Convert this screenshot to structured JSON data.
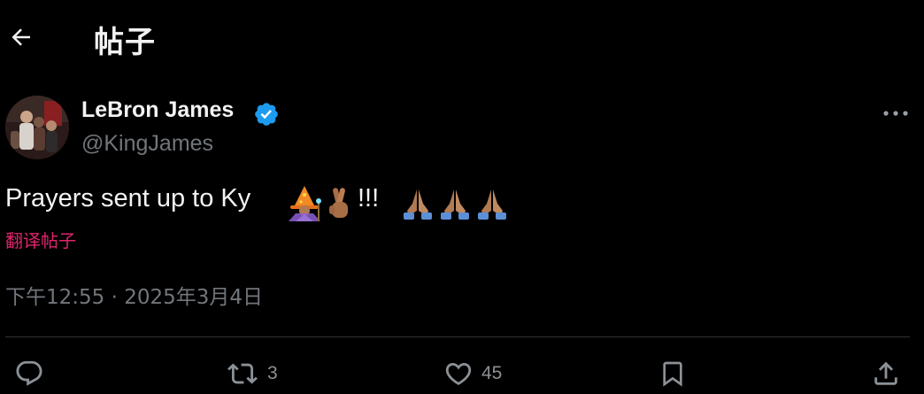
{
  "header": {
    "title": "帖子"
  },
  "author": {
    "display_name": "LeBron James",
    "handle": "@KingJames",
    "verified": true
  },
  "tweet": {
    "text": "Prayers sent up to Ky",
    "exclaim": "!!!",
    "emojis": [
      "wizard-emoji",
      "crossed-fingers-emoji",
      "folded-hands-emoji",
      "folded-hands-emoji",
      "folded-hands-emoji"
    ],
    "translate_label": "翻译帖子",
    "timestamp": "下午12:55 · 2025年3月4日"
  },
  "actions": {
    "reply": {
      "icon": "reply-icon",
      "count": ""
    },
    "retweet": {
      "icon": "retweet-icon",
      "count": "3"
    },
    "like": {
      "icon": "heart-icon",
      "count": "45"
    },
    "bookmark": {
      "icon": "bookmark-icon",
      "count": ""
    },
    "share": {
      "icon": "share-icon",
      "count": ""
    }
  },
  "colors": {
    "background": "#000000",
    "text": "#f3f3f3",
    "muted": "#71767b",
    "verified": "#1d9bf0",
    "translate": "#e0246d",
    "divider": "#2f3336"
  }
}
